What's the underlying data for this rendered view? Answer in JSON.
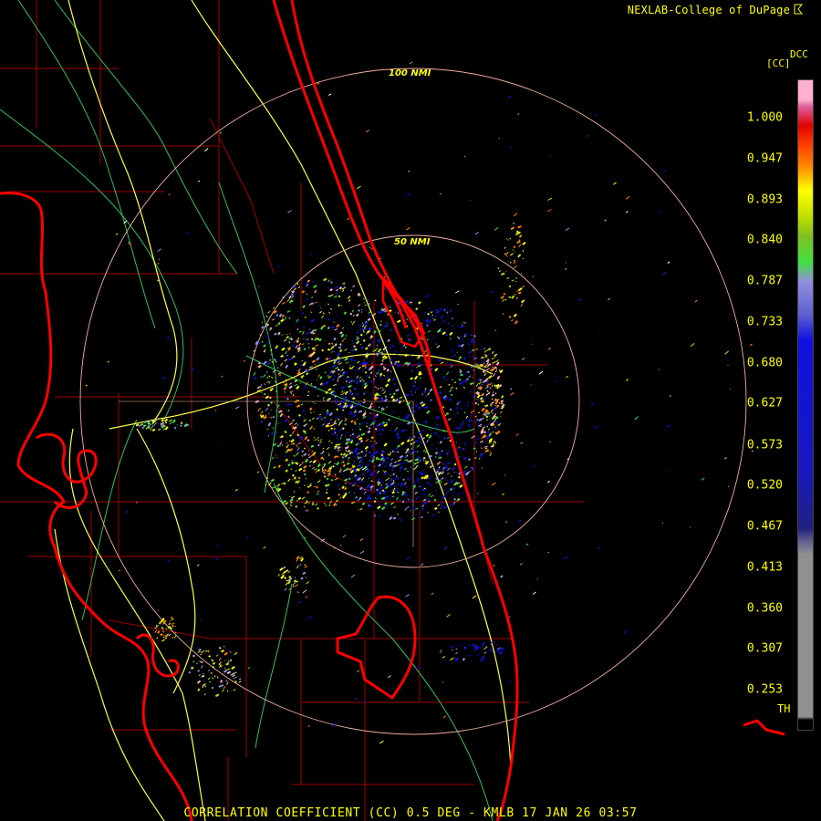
{
  "header": {
    "credit": "NEXLAB-College of DuPage",
    "logo_icon": "dupage-flag-icon"
  },
  "colorbar": {
    "product_code": "DCC",
    "units": "[CC]",
    "threshold_label": "TH",
    "ticks": [
      "1.000",
      "0.947",
      "0.893",
      "0.840",
      "0.787",
      "0.733",
      "0.680",
      "0.627",
      "0.573",
      "0.520",
      "0.467",
      "0.413",
      "0.360",
      "0.307",
      "0.253"
    ],
    "tick_values": [
      1.0,
      0.947,
      0.893,
      0.84,
      0.787,
      0.733,
      0.68,
      0.627,
      0.573,
      0.52,
      0.467,
      0.413,
      0.36,
      0.307,
      0.253
    ],
    "range": [
      0.2,
      1.05
    ],
    "colors": {
      "top": "#ffb0d0",
      "red": "#e00000",
      "orange": "#ff8000",
      "yellow": "#ffff00",
      "green": "#40e040",
      "lavender": "#9090e0",
      "blue": "#1010e0",
      "gray": "#909090",
      "bottom": "#000000"
    }
  },
  "rings": [
    {
      "label": "100 NMI"
    },
    {
      "label": "50 NMI"
    }
  ],
  "map": {
    "coastline_color": "#ff0000",
    "county_color": "#b00000",
    "highway_color": "#ffff40",
    "road_color": "#30c060",
    "ring_color": "#f0b0a0"
  },
  "footer": {
    "title": "CORRELATION COEFFICIENT (CC) 0.5 DEG - KMLB 17 JAN 26 03:57"
  }
}
